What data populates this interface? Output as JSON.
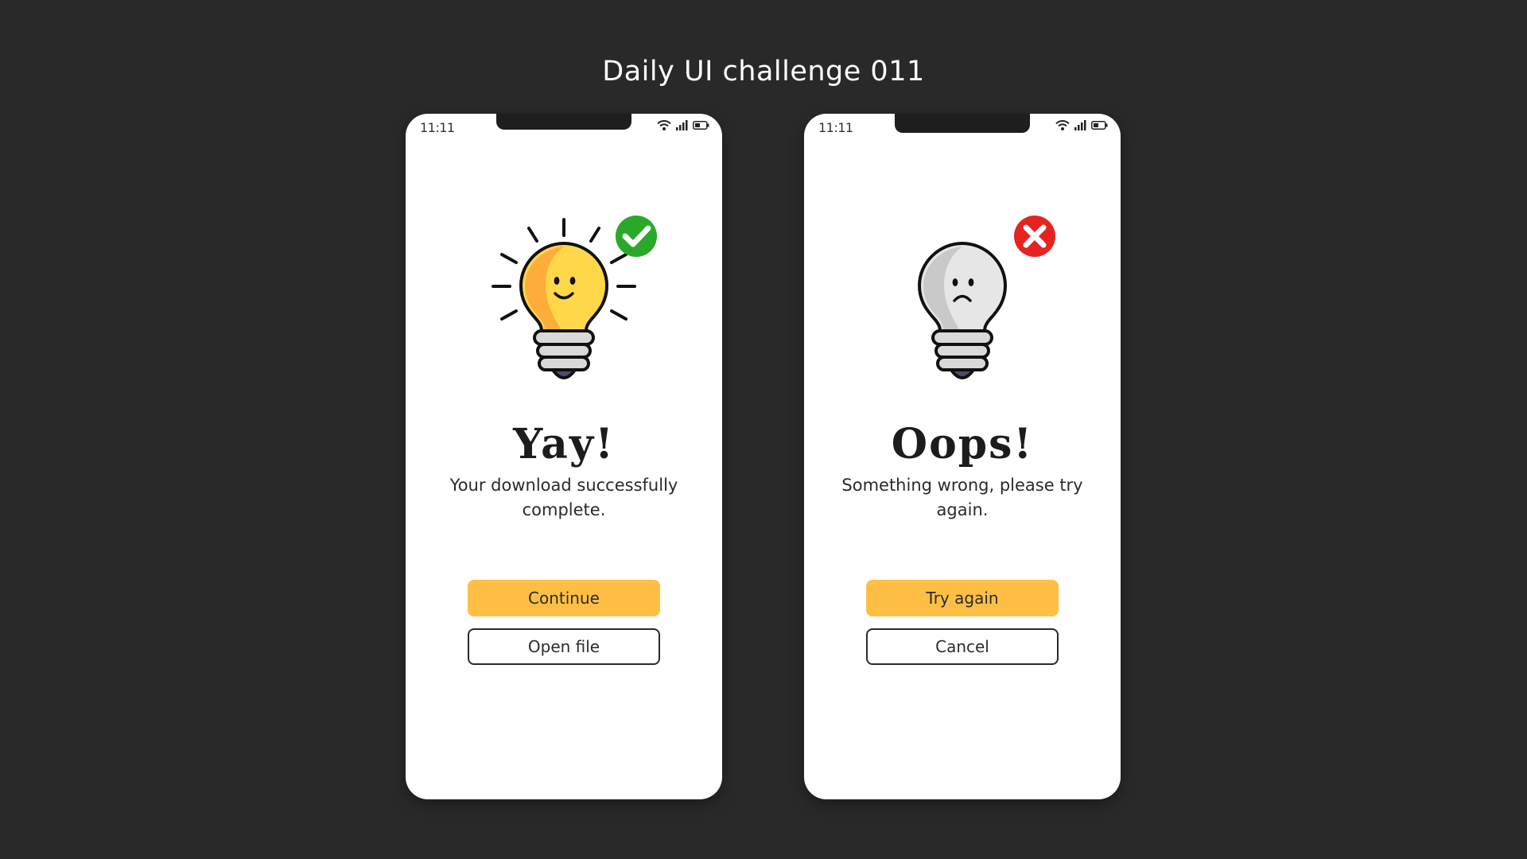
{
  "page": {
    "title": "Daily UI challenge 011"
  },
  "colors": {
    "background": "#292929",
    "accent": "#ffbf45",
    "success": "#2aa82a",
    "error": "#e62323"
  },
  "screens": [
    {
      "status_time": "11:11",
      "status_icons": [
        "wifi-icon",
        "signal-icon",
        "battery-icon"
      ],
      "badge_icon": "check-circle-icon",
      "illustration": "happy-lightbulb",
      "headline": "Yay!",
      "message": "Your download successfully complete.",
      "primary_button": "Continue",
      "secondary_button": "Open file"
    },
    {
      "status_time": "11:11",
      "status_icons": [
        "wifi-icon",
        "signal-icon",
        "battery-icon"
      ],
      "badge_icon": "x-circle-icon",
      "illustration": "sad-lightbulb",
      "headline": "Oops!",
      "message": "Something wrong, please try again.",
      "primary_button": "Try again",
      "secondary_button": "Cancel"
    }
  ]
}
